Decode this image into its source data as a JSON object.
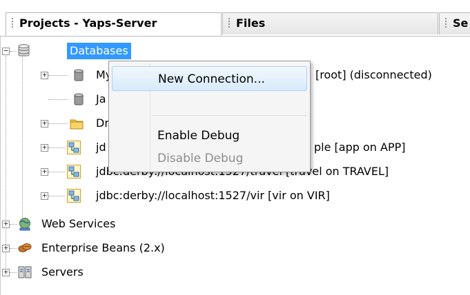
{
  "tabs": [
    {
      "label": "Projects - Yaps-Server"
    },
    {
      "label": "Files"
    },
    {
      "label": "Se"
    }
  ],
  "tree": {
    "databases": "Databases",
    "db_children": [
      {
        "label": "MySQL (Connector/J driver) on localhost:3306 [root] (disconnected)",
        "prefix": "My",
        "suffix": "[root] (disconnected)"
      },
      {
        "label": "Java DB",
        "prefix": "Ja"
      },
      {
        "label": "Drivers",
        "prefix": "Dr"
      },
      {
        "label": "jdbc:derby://localhost:1527/sample [app on APP]",
        "prefix": "jd",
        "suffix": "ple [app on APP]"
      },
      {
        "label": "jdbc:derby://localhost:1527/travel [travel on TRAVEL]"
      },
      {
        "label": "jdbc:derby://localhost:1527/vir [vir on VIR]"
      }
    ],
    "web_services": "Web Services",
    "enterprise_beans": "Enterprise Beans (2.x)",
    "servers": "Servers"
  },
  "context_menu": {
    "new_connection": "New Connection...",
    "enable_debug": "Enable Debug",
    "disable_debug": "Disable Debug"
  },
  "icons": {
    "database": "database-icon",
    "db_connection": "db-cylinder-icon",
    "drivers": "folder-icon",
    "connection": "connection-icon",
    "web_services": "globe-icon",
    "beans": "beans-icon",
    "servers": "server-icon"
  },
  "colors": {
    "selection": "#3399ff",
    "menu_hover": "#d8eafb",
    "disabled_text": "#8d8d8d"
  }
}
